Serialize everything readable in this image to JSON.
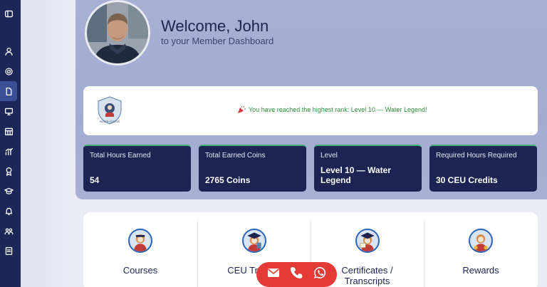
{
  "user": {
    "welcome": "Welcome, John",
    "subtitle": "to your Member Dashboard"
  },
  "sidebar": {
    "items": [
      {
        "icon": "collapse-icon"
      },
      {
        "icon": "user-icon"
      },
      {
        "icon": "gear-icon"
      },
      {
        "icon": "document-icon",
        "active": true
      },
      {
        "icon": "monitor-icon"
      },
      {
        "icon": "calendar-icon"
      },
      {
        "icon": "chart-icon"
      },
      {
        "icon": "award-icon"
      },
      {
        "icon": "graduation-cap-icon"
      },
      {
        "icon": "bell-icon"
      },
      {
        "icon": "group-icon"
      },
      {
        "icon": "report-icon"
      }
    ]
  },
  "rank": {
    "badge_text": "WATER LEGEND",
    "message": "You have reached the highest rank: Level 10 — Water Legend!"
  },
  "stats": [
    {
      "label": "Total Hours Earned",
      "value": "54"
    },
    {
      "label": "Total Earned Coins",
      "value": "2765 Coins"
    },
    {
      "label": "Level",
      "value": "Level 10 — Water Legend"
    },
    {
      "label": "Required Hours Required",
      "value": "30 CEU Credits"
    }
  ],
  "menu": [
    {
      "label": "Courses",
      "icon": "mascot-courses-icon"
    },
    {
      "label": "CEU Tracker",
      "icon": "mascot-graduate-icon"
    },
    {
      "label": "Certificates / Transcripts",
      "icon": "mascot-certificates-icon"
    },
    {
      "label": "Rewards",
      "icon": "mascot-rewards-icon"
    }
  ],
  "contact": {
    "email_icon": "email-icon",
    "phone_icon": "phone-icon",
    "whatsapp_icon": "whatsapp-icon"
  },
  "colors": {
    "sidebar": "#1b2757",
    "hero": "#a8b0d4",
    "stat_card": "#1d2452",
    "accent_green": "#3fb07a",
    "contact_red": "#e23a35"
  }
}
